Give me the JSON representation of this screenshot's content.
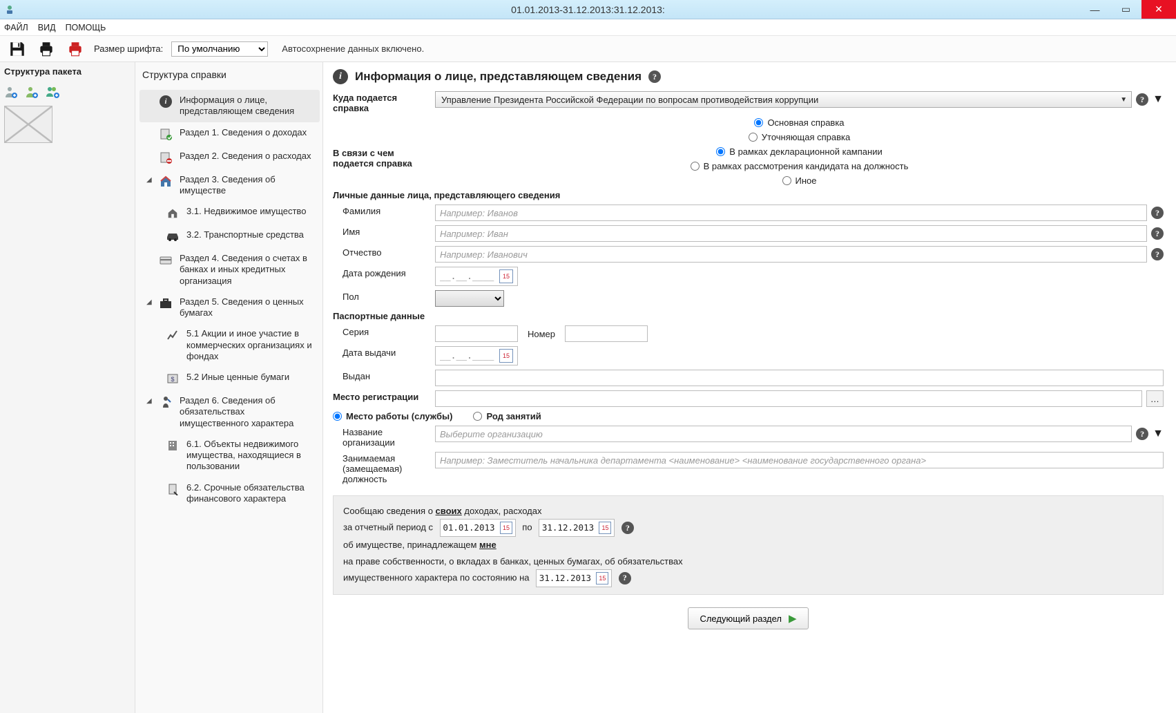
{
  "window": {
    "title": "01.01.2013-31.12.2013:31.12.2013:"
  },
  "menubar": {
    "file": "ФАЙЛ",
    "view": "ВИД",
    "help": "ПОМОЩЬ"
  },
  "toolbar": {
    "font_label": "Размер шрифта:",
    "font_value": "По умолчанию",
    "autosave": "Автосохрнение данных включено."
  },
  "leftcol": {
    "header": "Структура пакета"
  },
  "midcol": {
    "header": "Структура справки",
    "items": [
      {
        "label": "Информация о лице, представляющем сведения"
      },
      {
        "label": "Раздел 1. Сведения о доходах"
      },
      {
        "label": "Раздел 2. Сведения о расходах"
      },
      {
        "label": "Раздел 3. Сведения об имуществе"
      },
      {
        "label": "3.1. Недвижимое имущество"
      },
      {
        "label": "3.2. Транспортные средства"
      },
      {
        "label": "Раздел 4. Сведения о счетах в банках и иных кредитных организация"
      },
      {
        "label": "Раздел 5. Сведения о ценных бумагах"
      },
      {
        "label": "5.1 Акции и иное участие в коммерческих организациях и фондах"
      },
      {
        "label": "5.2 Иные ценные бумаги"
      },
      {
        "label": "Раздел 6. Сведения об обязательствах имущественного характера"
      },
      {
        "label": "6.1. Объекты недвижимого имущества, находящиеся в пользовании"
      },
      {
        "label": "6.2. Срочные обязательства финансового характера"
      }
    ]
  },
  "main": {
    "title": "Информация о лице, представляющем сведения",
    "where_label": "Куда подается справка",
    "where_value": "Управление Президента Российской Федерации по вопросам противодействия коррупции",
    "type_opts": {
      "main": "Основная справка",
      "clarify": "Уточняющая справка"
    },
    "reason_label": "В связи с чем подается справка",
    "reason_opts": {
      "campaign": "В рамках декларационной кампании",
      "candidate": "В рамках рассмотрения кандидата на должность",
      "other": "Иное"
    },
    "personal_hdr": "Личные данные лица, представляющего сведения",
    "surname": "Фамилия",
    "surname_ph": "Например: Иванов",
    "name": "Имя",
    "name_ph": "Например: Иван",
    "patronymic": "Отчество",
    "patronymic_ph": "Например: Иванович",
    "dob": "Дата рождения",
    "date_mask": "__.__.____",
    "gender": "Пол",
    "passport_hdr": "Паспортные данные",
    "series": "Серия",
    "number": "Номер",
    "issued_date": "Дата выдачи",
    "issued_by": "Выдан",
    "reg_label": "Место регистрации",
    "work_label": "Место работы (службы)",
    "occupation_label": "Род занятий",
    "org_label": "Название организации",
    "org_ph": "Выберите организацию",
    "pos_label": "Занимаемая (замещаемая) должность",
    "pos_ph": "Например: Заместитель начальника департамента <наименование> <наименование государственного органа>",
    "summary": {
      "l1a": "Сообщаю сведения о ",
      "l1b": "своих",
      "l1c": " доходах, расходах",
      "l2a": "за отчетный период с",
      "d1": "01.01.2013",
      "l2b": "по",
      "d2": "31.12.2013",
      "l3a": "об имуществе, принадлежащем ",
      "l3b": "мне",
      "l4": "на праве собственности, о вкладах в банках, ценных бумагах, об обязательствах",
      "l5a": "имущественного характера по состоянию на",
      "d3": "31.12.2013"
    },
    "next_btn": "Следующий раздел"
  }
}
